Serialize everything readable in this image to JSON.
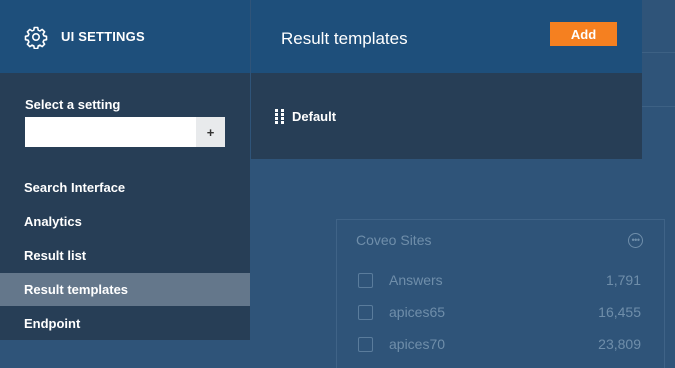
{
  "sidebar": {
    "title": "UI SETTINGS",
    "icon": "gear-icon",
    "select_label": "Select a setting",
    "search_value": "",
    "add_label": "+",
    "items": [
      {
        "label": "Search Interface",
        "active": false
      },
      {
        "label": "Analytics",
        "active": false
      },
      {
        "label": "Result list",
        "active": false
      },
      {
        "label": "Result templates",
        "active": true
      },
      {
        "label": "Endpoint",
        "active": false
      }
    ]
  },
  "panel": {
    "title": "Result templates",
    "add_label": "Add",
    "templates": [
      {
        "label": "Default",
        "icon": "drag-handle-icon"
      }
    ]
  },
  "background": {
    "facet": {
      "title": "Coveo Sites",
      "values": [
        {
          "label": "Answers",
          "count": "1,791"
        },
        {
          "label": "apices65",
          "count": "16,455"
        },
        {
          "label": "apices70",
          "count": "23,809"
        }
      ]
    }
  },
  "colors": {
    "header_blue": "#1e4f7b",
    "panel_dark": "#273e56",
    "active_item": "#64778b",
    "accent_orange": "#f58020",
    "page_background": "#2f5479"
  }
}
